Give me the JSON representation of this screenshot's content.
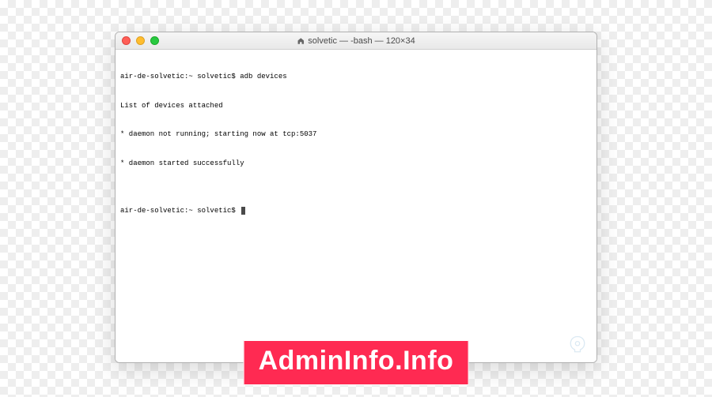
{
  "window": {
    "title": "solvetic — -bash — 120×34"
  },
  "terminal": {
    "lines": [
      "air-de-solvetic:~ solvetic$ adb devices",
      "List of devices attached",
      "* daemon not running; starting now at tcp:5037",
      "* daemon started successfully",
      "",
      "air-de-solvetic:~ solvetic$ "
    ]
  },
  "watermark": {
    "text": "AdminInfo.Info"
  }
}
